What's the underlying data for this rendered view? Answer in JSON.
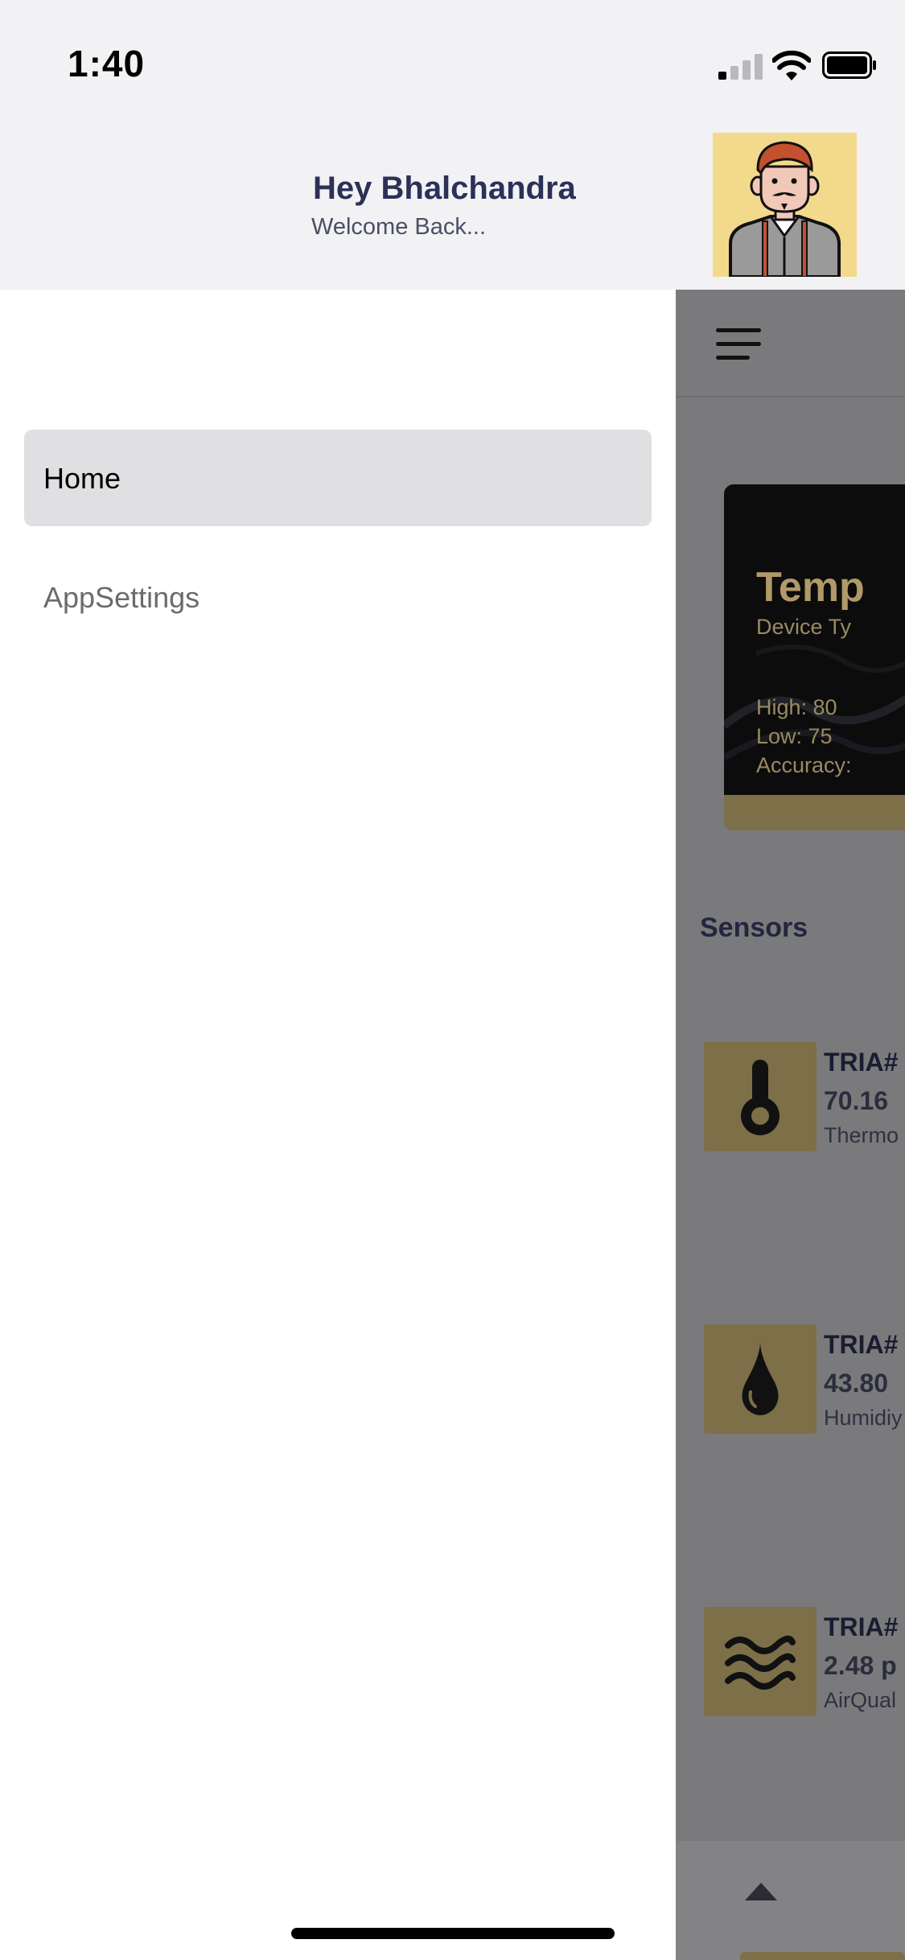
{
  "status_bar": {
    "time": "1:40"
  },
  "header": {
    "greeting": "Hey Bhalchandra",
    "subtitle": "Welcome Back..."
  },
  "drawer": {
    "items": [
      {
        "label": "Home",
        "active": true
      },
      {
        "label": "AppSettings",
        "active": false
      }
    ]
  },
  "main": {
    "device_card": {
      "title": "Temp",
      "device_type": "Device Ty",
      "high": "High: 80",
      "low": "Low: 75",
      "accuracy": "Accuracy:"
    },
    "sensors_title": "Sensors",
    "sensors": [
      {
        "id": "TRIA#",
        "value": "70.16",
        "type": "Thermo",
        "icon": "thermometer-icon"
      },
      {
        "id": "TRIA#",
        "value": "43.80",
        "type": "Humidiy",
        "icon": "water-drop-icon"
      },
      {
        "id": "TRIA#",
        "value": "2.48 p",
        "type": "AirQual",
        "icon": "air-waves-icon"
      }
    ]
  },
  "colors": {
    "accent_gold": "#7d6f48",
    "avatar_bg": "#f3d98c",
    "heading": "#2b3157"
  }
}
